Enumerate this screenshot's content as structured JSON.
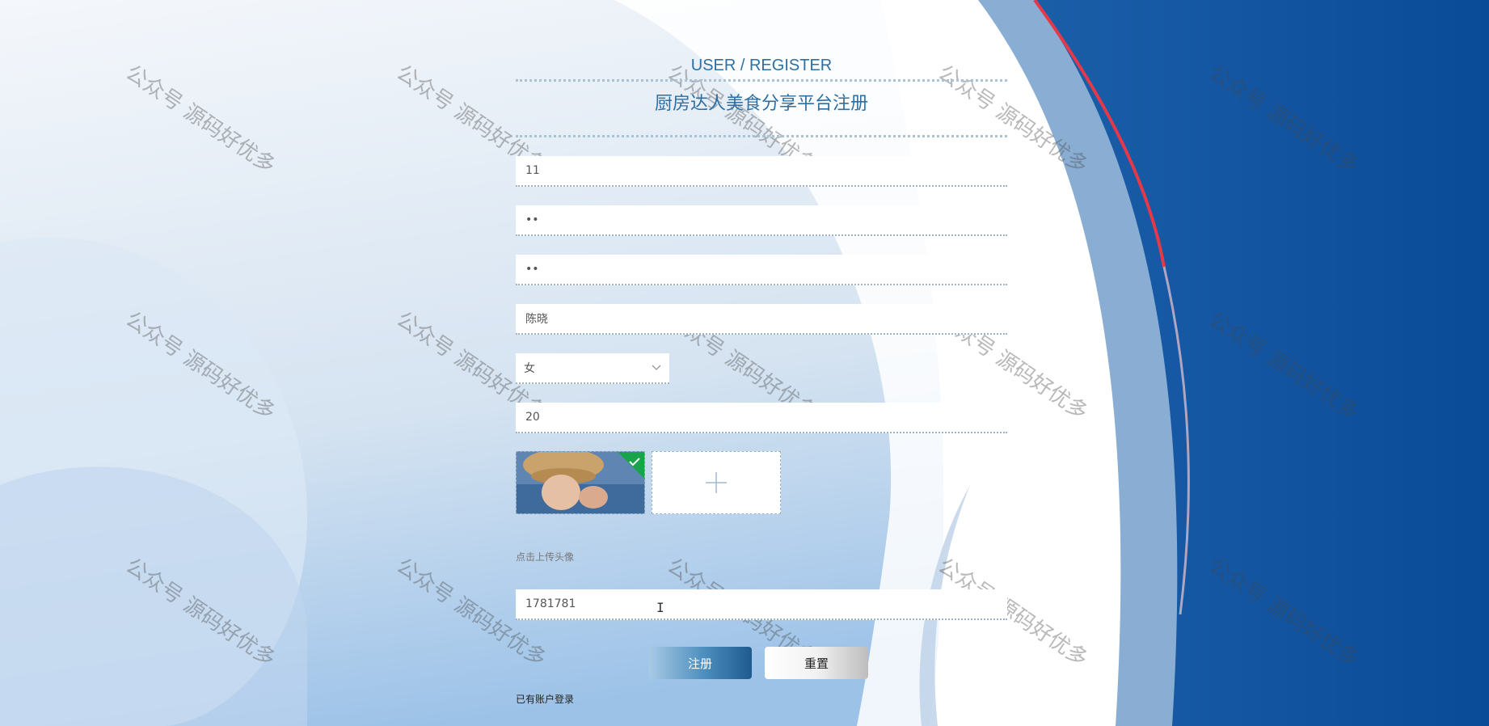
{
  "header": {
    "title_en": "USER / REGISTER",
    "title_cn": "厨房达人美食分享平台注册"
  },
  "form": {
    "account_value": "11",
    "password_value": "••",
    "confirm_password_value": "••",
    "name_value": "陈晓",
    "gender_selected": "女",
    "age_value": "20",
    "avatar_hint": "点击上传头像",
    "phone_value": "1781781"
  },
  "buttons": {
    "register": "注册",
    "reset": "重置"
  },
  "links": {
    "login": "已有账户登录"
  },
  "watermark": "公众号 源码好优多",
  "colors": {
    "accent": "#2d6fa3",
    "right_panel": "#0a4f9c",
    "edge_red": "#e5394a"
  },
  "icons": {
    "dropdown": "chevron-down-icon",
    "add": "plus-icon",
    "uploaded_check": "check-icon"
  }
}
